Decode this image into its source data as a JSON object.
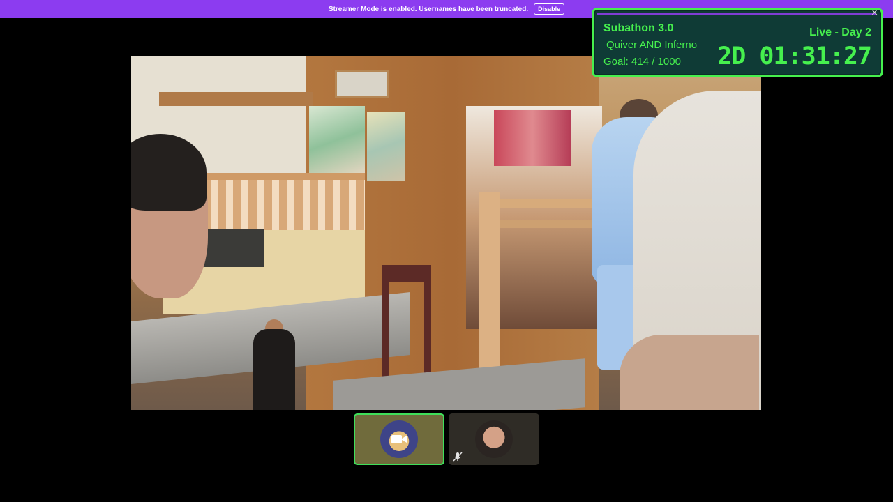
{
  "banner": {
    "message": "Streamer Mode is enabled. Usernames have been truncated.",
    "button_label": "Disable"
  },
  "overlay": {
    "title": "Subathon 3.0",
    "subtitle": "Quiver AND Inferno",
    "goal": "Goal: 414 / 1000",
    "status": "Live - Day 2",
    "timer": "2D 01:31:27",
    "close_glyph": "×",
    "accent_color": "#46f04e"
  },
  "participants": [
    {
      "icon": "video-camera-icon",
      "active": true
    },
    {
      "icon": "muted-microphone-icon",
      "active": false
    }
  ]
}
